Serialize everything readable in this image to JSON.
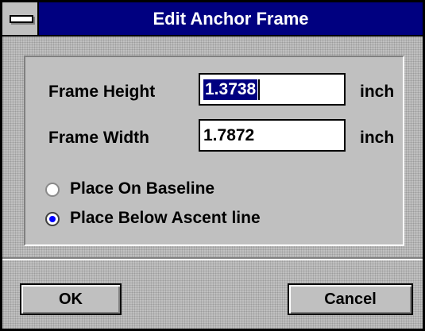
{
  "window": {
    "title": "Edit Anchor Frame"
  },
  "frame_height": {
    "label": "Frame Height",
    "value": "1.3738",
    "unit": "inch"
  },
  "frame_width": {
    "label": "Frame Width",
    "value": "1.7872",
    "unit": "inch"
  },
  "placement": {
    "options": [
      {
        "label": "Place On Baseline",
        "selected": false
      },
      {
        "label": "Place Below Ascent line",
        "selected": true
      }
    ]
  },
  "buttons": {
    "ok": "OK",
    "cancel": "Cancel"
  },
  "colors": {
    "titlebar": "#000080",
    "face": "#c0c0c0",
    "radio_dot": "#0000ff"
  }
}
